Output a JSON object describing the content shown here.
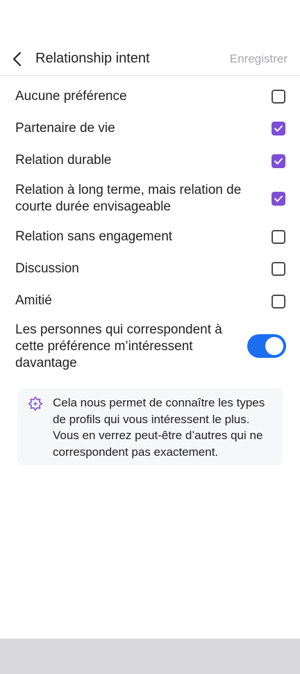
{
  "header": {
    "title": "Relationship intent",
    "save_label": "Enregistrer"
  },
  "options": [
    {
      "label": "Aucune préférence",
      "checked": false
    },
    {
      "label": "Partenaire de vie",
      "checked": true
    },
    {
      "label": "Relation durable",
      "checked": true
    },
    {
      "label": "Relation à long terme, mais relation de courte durée envisageable",
      "checked": true
    },
    {
      "label": "Relation sans engagement",
      "checked": false
    },
    {
      "label": "Discussion",
      "checked": false
    },
    {
      "label": "Amitié",
      "checked": false
    }
  ],
  "preference_toggle": {
    "label": "Les personnes qui correspondent à cette préférence m’intéressent davantage",
    "on": true
  },
  "info": {
    "text": "Cela nous permet de connaître les types de profils qui vous intéressent le plus. Vous en verrez peut-être d’autres qui ne correspondent pas exactement."
  },
  "colors": {
    "accent_purple": "#7d4fd6",
    "toggle_blue": "#1a6ef0",
    "save_gray": "#a6a6ab"
  }
}
